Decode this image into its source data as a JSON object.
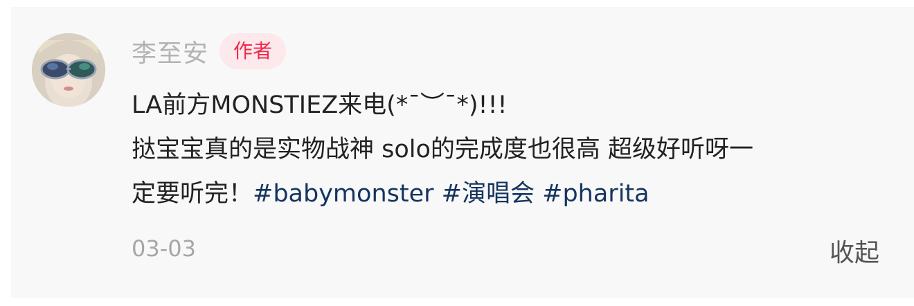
{
  "comment": {
    "author_name": "李至安",
    "author_badge": "作者",
    "text_line1": "LA前方MONSTIEZ来电(*¯︶¯*)!!!",
    "text_line2": "挞宝宝真的是实物战神 solo的完成度也很高 超级好听呀一",
    "text_line3_prefix": "定要听完！",
    "tags": [
      "#babymonster",
      "#演唱会",
      "#pharita"
    ],
    "date": "03-03",
    "collapse_label": "收起"
  },
  "colors": {
    "badge_bg": "#fde8ec",
    "badge_text": "#f0284a",
    "tag_text": "#15345f",
    "card_bg": "#f8f8f8"
  }
}
